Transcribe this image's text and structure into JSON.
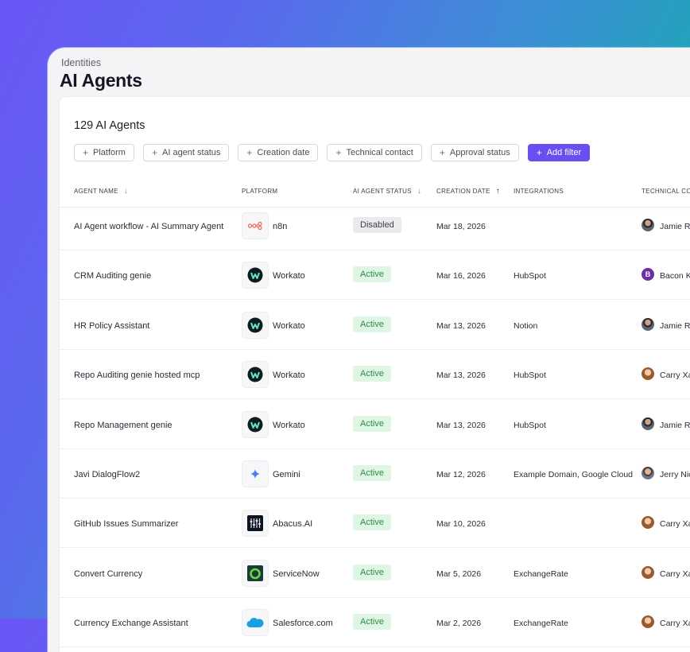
{
  "header": {
    "breadcrumb": "Identities",
    "title": "AI Agents"
  },
  "table_header": {
    "count": "129 AI Agents"
  },
  "filters": [
    {
      "label": "Platform",
      "icon": "plus-icon"
    },
    {
      "label": "AI agent status",
      "icon": "plus-icon"
    },
    {
      "label": "Creation date",
      "icon": "plus-icon"
    },
    {
      "label": "Technical contact",
      "icon": "plus-icon"
    },
    {
      "label": "Approval status",
      "icon": "plus-icon"
    }
  ],
  "add_filter": {
    "label": "Add filter",
    "icon": "plus-icon"
  },
  "columns": {
    "agent_name": "AGENT NAME",
    "platform": "PLATFORM",
    "status": "AI AGENT STATUS",
    "creation_date": "CREATION DATE",
    "integrations": "INTEGRATIONS",
    "technical_contact": "TECHNICAL CO"
  },
  "rows": [
    {
      "name": "AI Agent workflow - AI Summary Agent",
      "platform": "n8n",
      "platform_icon": "n8n-logo-icon",
      "status": "Disabled",
      "date": "Mar 18, 2026",
      "integrations": "",
      "contact": "Jamie Ro",
      "contact_avatar": "photo"
    },
    {
      "name": "CRM Auditing genie",
      "platform": "Workato",
      "platform_icon": "workato-logo-icon",
      "status": "Active",
      "date": "Mar 16, 2026",
      "integrations": "HubSpot",
      "contact": "Bacon K",
      "contact_avatar": "B"
    },
    {
      "name": "HR Policy Assistant",
      "platform": "Workato",
      "platform_icon": "workato-logo-icon",
      "status": "Active",
      "date": "Mar 13, 2026",
      "integrations": "Notion",
      "contact": "Jamie Ro",
      "contact_avatar": "photo"
    },
    {
      "name": "Repo Auditing genie hosted mcp",
      "platform": "Workato",
      "platform_icon": "workato-logo-icon",
      "status": "Active",
      "date": "Mar 13, 2026",
      "integrations": "HubSpot",
      "contact": "Carry Xa",
      "contact_avatar": "photo"
    },
    {
      "name": "Repo Management genie",
      "platform": "Workato",
      "platform_icon": "workato-logo-icon",
      "status": "Active",
      "date": "Mar 13, 2026",
      "integrations": "HubSpot",
      "contact": "Jamie Ro",
      "contact_avatar": "photo"
    },
    {
      "name": "Javi DialogFlow2",
      "platform": "Gemini",
      "platform_icon": "gemini-logo-icon",
      "status": "Active",
      "date": "Mar 12, 2026",
      "integrations": "Example Domain, Google Cloud",
      "contact": "Jerry Nic",
      "contact_avatar": "photo"
    },
    {
      "name": "GitHub Issues Summarizer",
      "platform": "Abacus.AI",
      "platform_icon": "abacus-logo-icon",
      "status": "Active",
      "date": "Mar 10, 2026",
      "integrations": "",
      "contact": "Carry Xa",
      "contact_avatar": "photo"
    },
    {
      "name": "Convert Currency",
      "platform": "ServiceNow",
      "platform_icon": "servicenow-logo-icon",
      "status": "Active",
      "date": "Mar 5, 2026",
      "integrations": "ExchangeRate",
      "contact": "Carry Xa",
      "contact_avatar": "photo"
    },
    {
      "name": "Currency Exchange Assistant",
      "platform": "Salesforce.com",
      "platform_icon": "salesforce-logo-icon",
      "status": "Active",
      "date": "Mar 2, 2026",
      "integrations": "ExchangeRate",
      "contact": "Carry Xa",
      "contact_avatar": "photo"
    }
  ],
  "colors": {
    "accent": "#6b4ef0",
    "active_bg": "#dff6e4",
    "active_text": "#2f8a47",
    "disabled_bg": "#ebebef"
  }
}
